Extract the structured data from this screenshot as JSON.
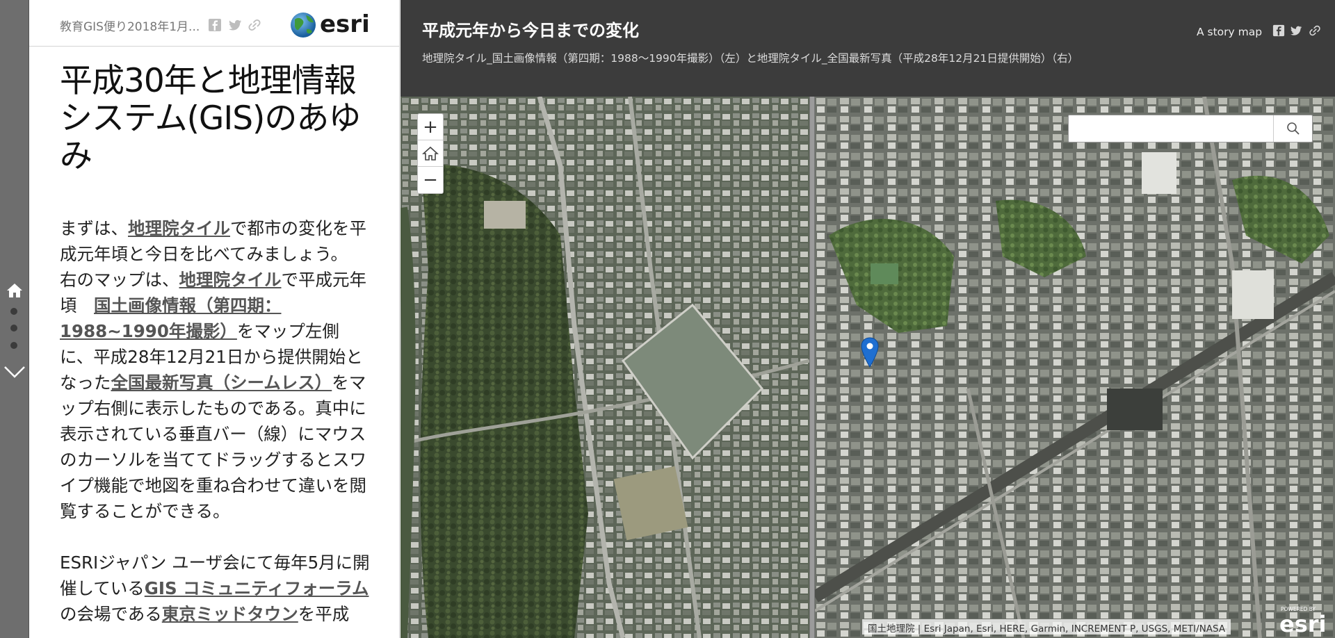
{
  "panel": {
    "header_title": "教育GIS便り2018年1月...",
    "title": "平成30年と地理情報システム(GIS)のあゆみ",
    "p1_before": "まずは、",
    "p1_link": "地理院タイル",
    "p1_after": "で都市の変化を平成元年頃と今日を比べてみましょう。",
    "p2_a": "右のマップは、",
    "p2_link1": "地理院タイル",
    "p2_b": "で平成元年頃　",
    "p2_link2": "国土画像情報（第四期：1988~1990年撮影）",
    "p2_c": "をマップ左側に、平成28年12月21日から提供開始となった",
    "p2_link3": "全国最新写真（シームレス）",
    "p2_d": "をマップ右側に表示したものである。真中に表示されている垂直バー（線）にマウスのカーソルを当ててドラッグするとスワイプ機能で地図を重ね合わせて違いを閲覧することができる。",
    "p3_a": "ESRIジャパン ユーザ会にて毎年5月に開催している",
    "p3_link": "GIS コミュニティフォーラム",
    "p3_b": "の会場である",
    "p3_link2": "東京ミッドタウン",
    "p3_c": "を平成"
  },
  "header": {
    "title": "平成元年から今日までの変化",
    "subtitle": "地理院タイル_国土画像情報（第四期：1988～1990年撮影）（左）と地理院タイル_全国最新写真（平成28年12月21日提供開始）（右）",
    "story_map_label": "A story map"
  },
  "map": {
    "zoom_in": "+",
    "home": "home-icon",
    "zoom_out": "−",
    "search_placeholder": "",
    "attribution": "国土地理院 | Esri Japan, Esri, HERE, Garmin, INCREMENT P, USGS, METI/NASA",
    "powered_by": "POWERED BY",
    "powered_brand": "esri"
  },
  "brand": {
    "logo": "esri"
  },
  "colors": {
    "header_bg": "#3c3c3c",
    "rail_bg": "#6e6e6e",
    "pin": "#1f6fd1",
    "link": "#555555"
  }
}
